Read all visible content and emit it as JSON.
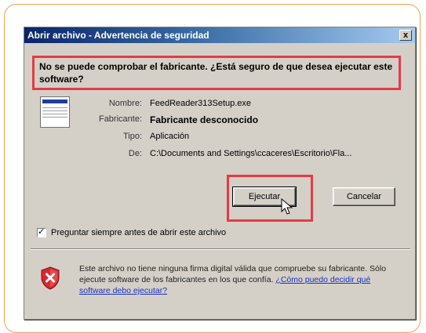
{
  "window": {
    "title": "Abrir archivo - Advertencia de seguridad",
    "close_label": "x"
  },
  "warning": {
    "question": "No se puede comprobar el fabricante. ¿Está seguro de que desea ejecutar este software?"
  },
  "details": {
    "name_label": "Nombre:",
    "name_value": "FeedReader313Setup.exe",
    "publisher_label": "Fabricante:",
    "publisher_value": "Fabricante desconocido",
    "type_label": "Tipo:",
    "type_value": "Aplicación",
    "from_label": "De:",
    "from_value": "C:\\Documents and Settings\\ccaceres\\Escritorio\\Fla..."
  },
  "buttons": {
    "run_label": "Ejecutar",
    "cancel_label": "Cancelar"
  },
  "checkbox": {
    "label": "Preguntar siempre antes de abrir este archivo",
    "checked": true
  },
  "info": {
    "text": "Este archivo no tiene ninguna firma digital válida que compruebe su fabricante. Sólo ejecute software de los fabricantes en los que confía.",
    "link": "¿Cómo puedo decidir qué software debo ejecutar?"
  },
  "icons": {
    "file": "file-icon",
    "shield": "shield-warning-icon",
    "cursor": "mouse-pointer-icon"
  },
  "colors": {
    "highlight": "#e53b45",
    "title_bar": "#0a246a",
    "link": "#1a2fc4",
    "frame": "#f0a24a"
  }
}
